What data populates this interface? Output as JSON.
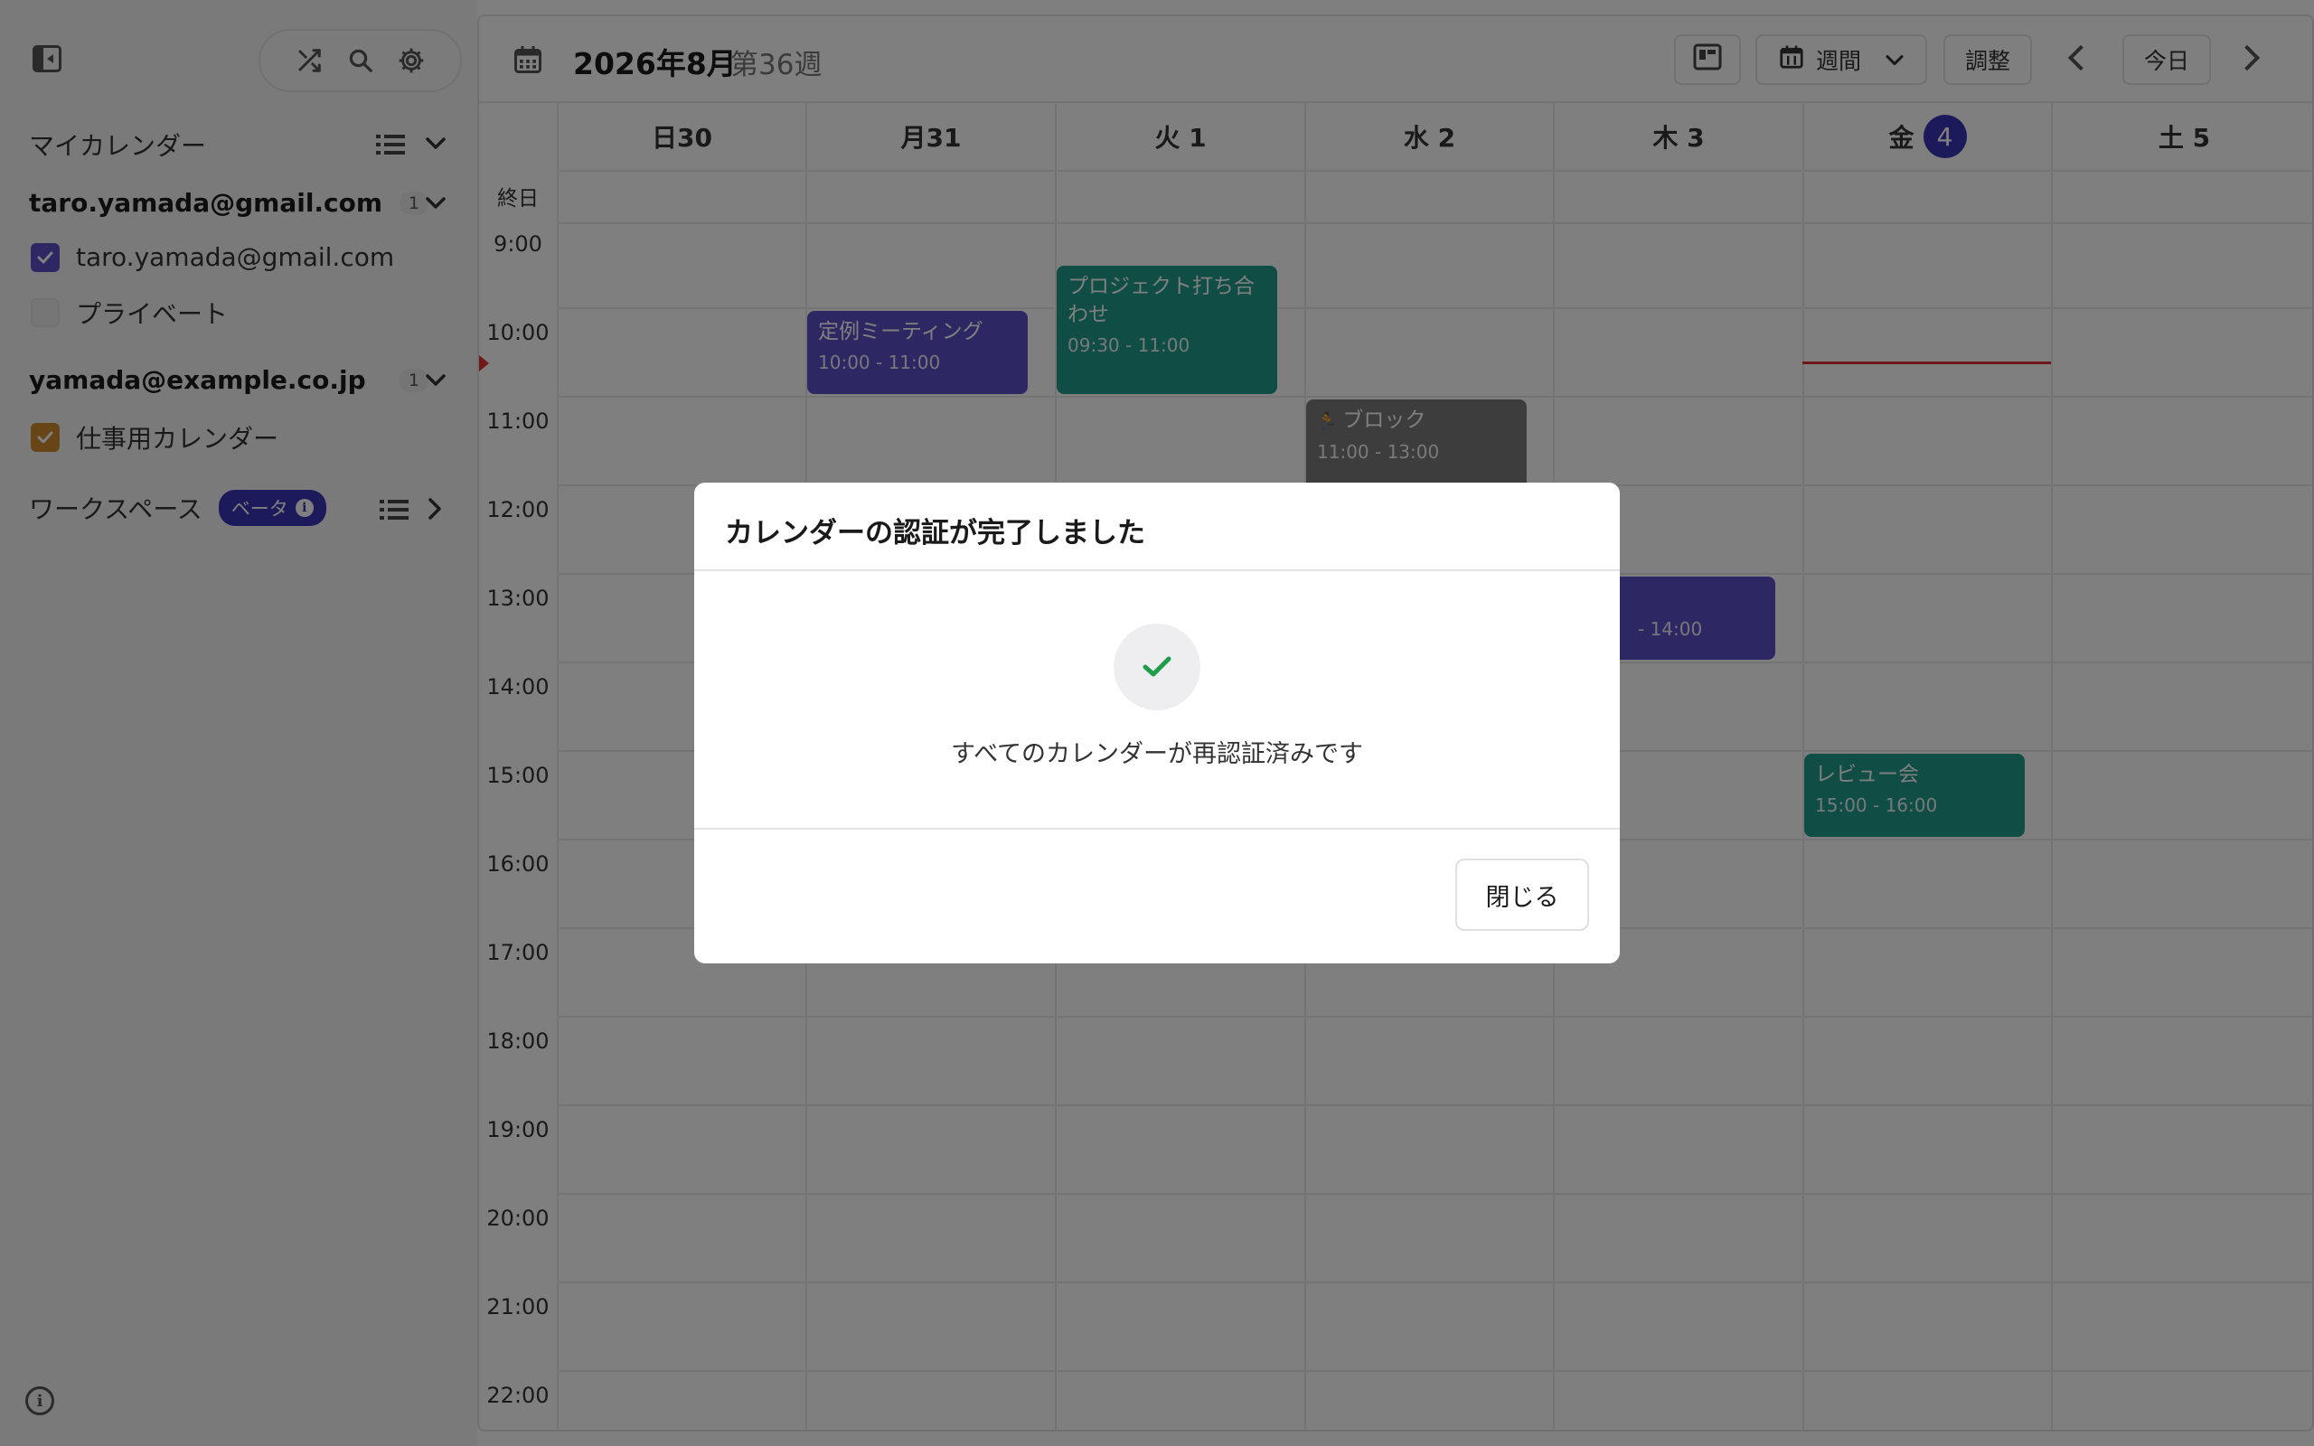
{
  "sidebar": {
    "my_calendars_label": "マイカレンダー",
    "accounts": [
      {
        "email": "taro.yamada@gmail.com",
        "count": "1",
        "calendars": [
          {
            "name": "taro.yamada@gmail.com",
            "checked": true,
            "color": "#5a50c8"
          },
          {
            "name": "プライベート",
            "checked": false
          }
        ]
      },
      {
        "email": "yamada@example.co.jp",
        "count": "1",
        "calendars": [
          {
            "name": "仕事用カレンダー",
            "checked": true,
            "color": "#d18b2e"
          }
        ]
      }
    ],
    "workspace_label": "ワークスペース",
    "beta_label": "ベータ"
  },
  "header": {
    "title": "2026年8月",
    "week": "第36週",
    "view_label": "週間",
    "adjust_label": "調整",
    "today_label": "今日"
  },
  "days": [
    {
      "label": "日30",
      "is_today": false
    },
    {
      "label": "月31",
      "is_today": false
    },
    {
      "label": "火 1",
      "is_today": false
    },
    {
      "label": "水 2",
      "is_today": false
    },
    {
      "label": "木 3",
      "is_today": false
    },
    {
      "label": "金",
      "day_num": "4",
      "is_today": true
    },
    {
      "label": "土 5",
      "is_today": false
    }
  ],
  "all_day_label": "終日",
  "time_labels": [
    "9:00",
    "10:00",
    "11:00",
    "12:00",
    "13:00",
    "14:00",
    "15:00",
    "16:00",
    "17:00",
    "18:00",
    "19:00",
    "20:00",
    "21:00",
    "22:00"
  ],
  "events": [
    {
      "title": "定例ミーティング",
      "time": "10:00 - 11:00",
      "day": 1,
      "color": "purple"
    },
    {
      "title": "プロジェクト打ち合わせ",
      "time": "09:30 - 11:00",
      "day": 2,
      "color": "teal"
    },
    {
      "title": "ブロック",
      "time": "11:00 - 13:00",
      "day": 3,
      "color": "gray",
      "icon": "🏃"
    },
    {
      "title": "",
      "time": "- 14:00",
      "day": 4,
      "color": "purple"
    },
    {
      "title": "レビュー会",
      "time": "15:00 - 16:00",
      "day": 5,
      "color": "teal"
    }
  ],
  "modal": {
    "title": "カレンダーの認証が完了しました",
    "message": "すべてのカレンダーが再認証済みです",
    "close_label": "閉じる",
    "accent_color": "#1f9e4a"
  },
  "colors": {
    "accent": "#3b35b8",
    "now_line": "#e03030"
  }
}
